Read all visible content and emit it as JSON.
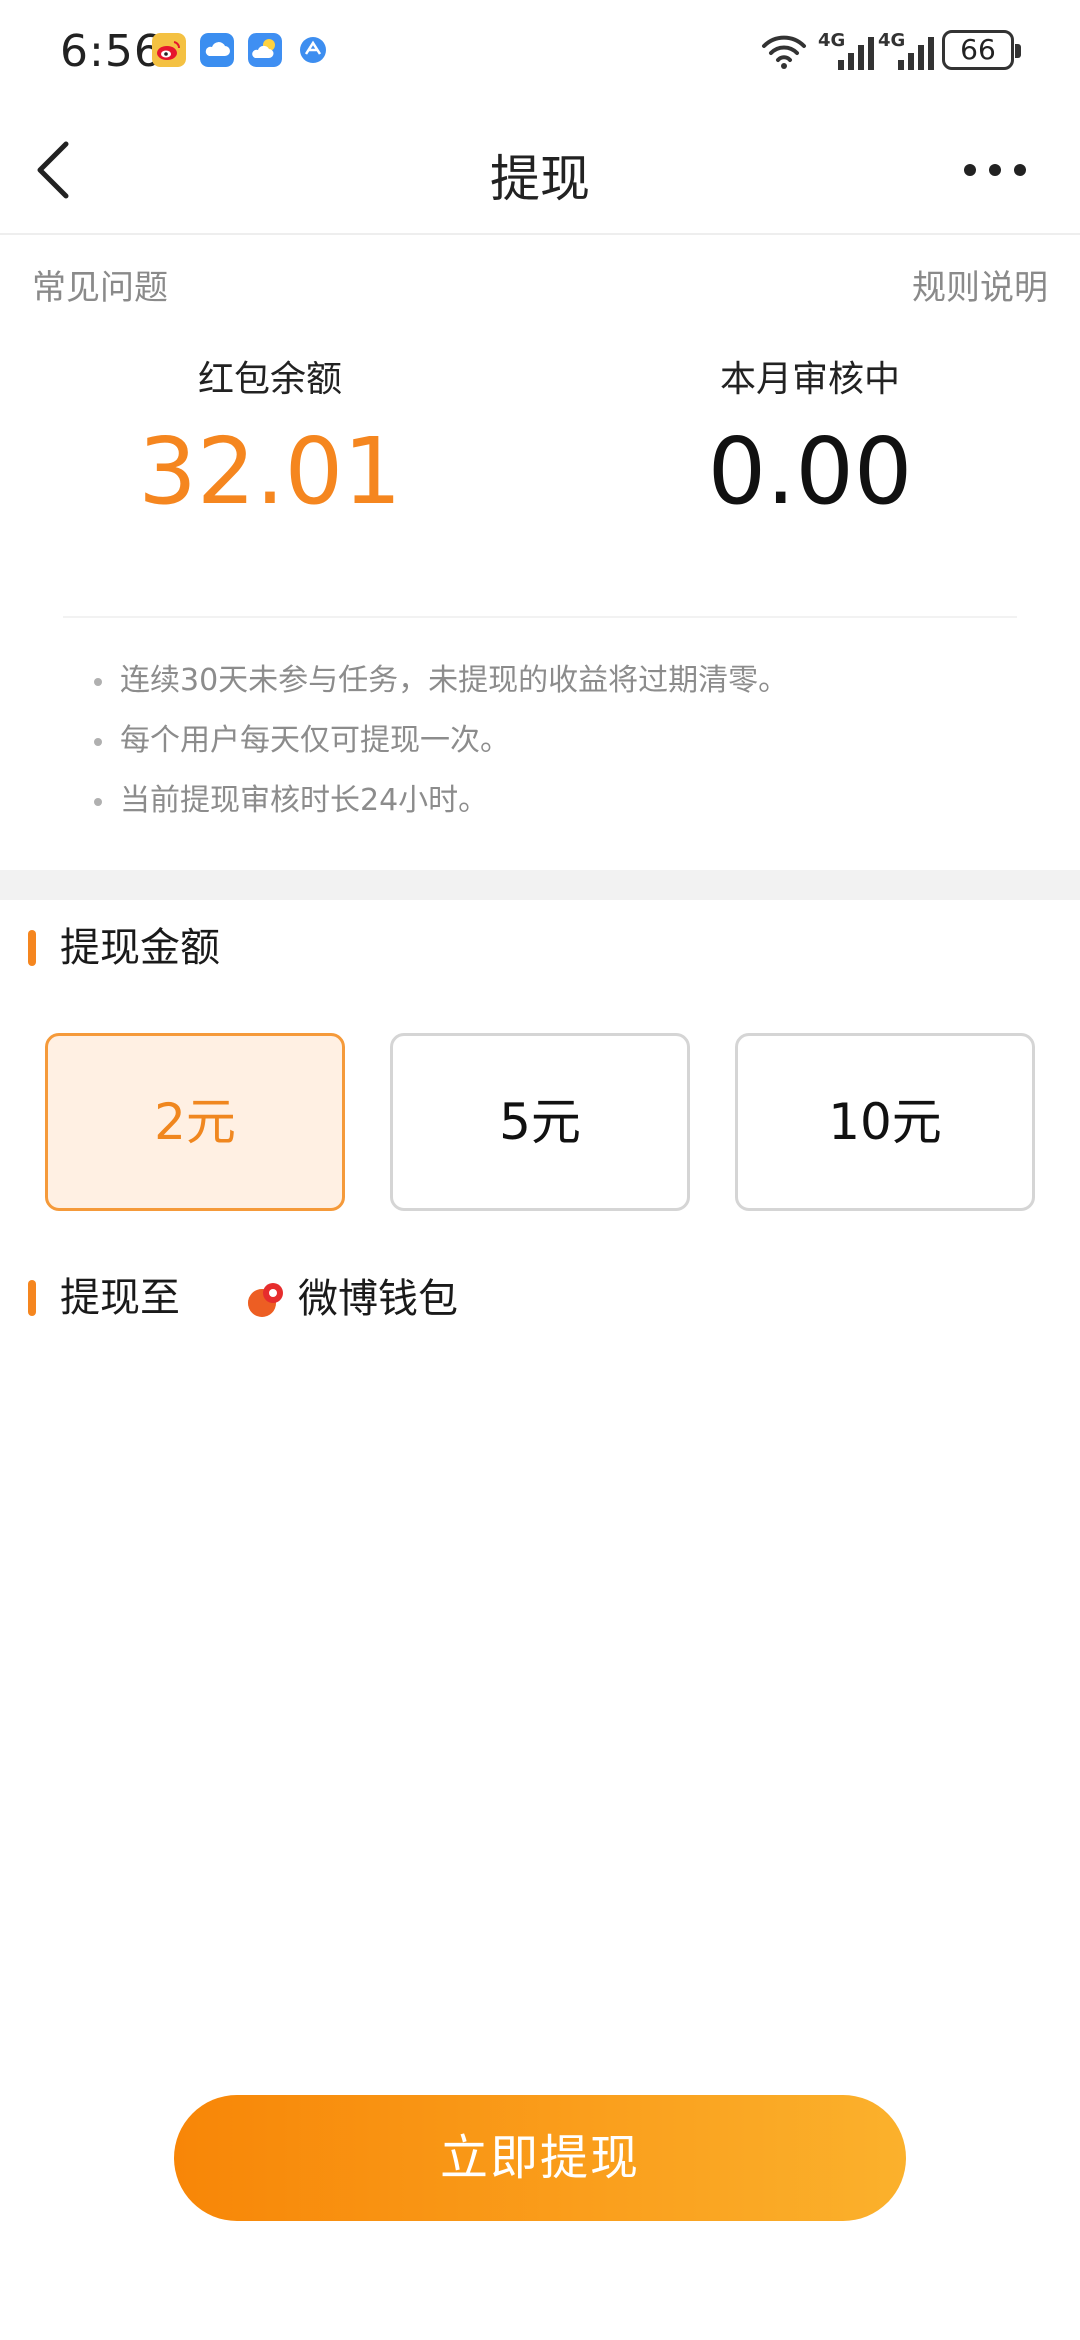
{
  "status_bar": {
    "time": "6:56",
    "network_1": "4G",
    "network_2": "4G",
    "battery": "66"
  },
  "nav": {
    "title": "提现"
  },
  "links": {
    "faq": "常见问题",
    "rules": "规则说明"
  },
  "balance": {
    "label": "红包余额",
    "value": "32.01",
    "value_color": "#f5861f"
  },
  "reviewing": {
    "label": "本月审核中",
    "value": "0.00"
  },
  "notes": [
    "连续30天未参与任务，未提现的收益将过期清零。",
    "每个用户每天仅可提现一次。",
    "当前提现审核时长24小时。"
  ],
  "amount_section": {
    "title": "提现金额",
    "options": [
      {
        "label": "2元",
        "selected": true
      },
      {
        "label": "5元",
        "selected": false
      },
      {
        "label": "10元",
        "selected": false
      }
    ]
  },
  "destination": {
    "title": "提现至",
    "wallet": "微博钱包"
  },
  "submit": {
    "label": "立即提现"
  },
  "colors": {
    "accent": "#f5861f",
    "button_start": "#f88607",
    "button_end": "#fbb12c"
  }
}
